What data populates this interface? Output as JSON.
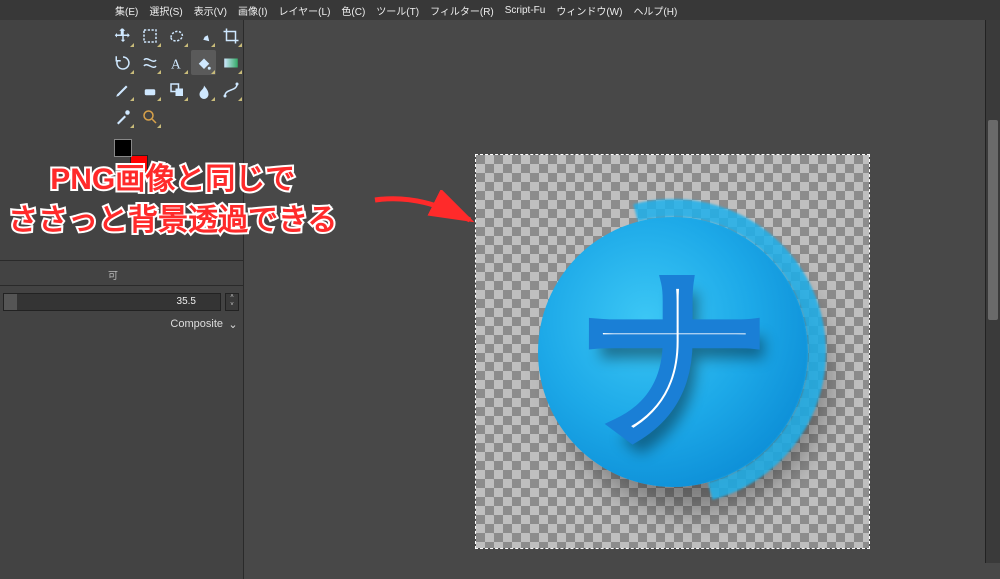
{
  "menu": {
    "edit": "集(E)",
    "select": "選択(S)",
    "view": "表示(V)",
    "image": "画像(I)",
    "layer": "レイヤー(L)",
    "color": "色(C)",
    "tools": "ツール(T)",
    "filter": "フィルター(R)",
    "scriptfu": "Script-Fu",
    "window": "ウィンドウ(W)",
    "help": "ヘルプ(H)"
  },
  "panel": {
    "small_label": "可",
    "size_value": "35.5",
    "mode_label": "Composite"
  },
  "annotation": {
    "line1": "PNG画像と同じで",
    "line2": "ささっと背景透過できる"
  },
  "canvas": {
    "glyph": "ナ"
  },
  "colors": {
    "accent_red": "#ff2a2a",
    "fg": "#000000",
    "bg": "#ff0000"
  },
  "icons": {
    "chev_down": "⌄",
    "spin_up": "˄",
    "spin_down": "˅"
  }
}
